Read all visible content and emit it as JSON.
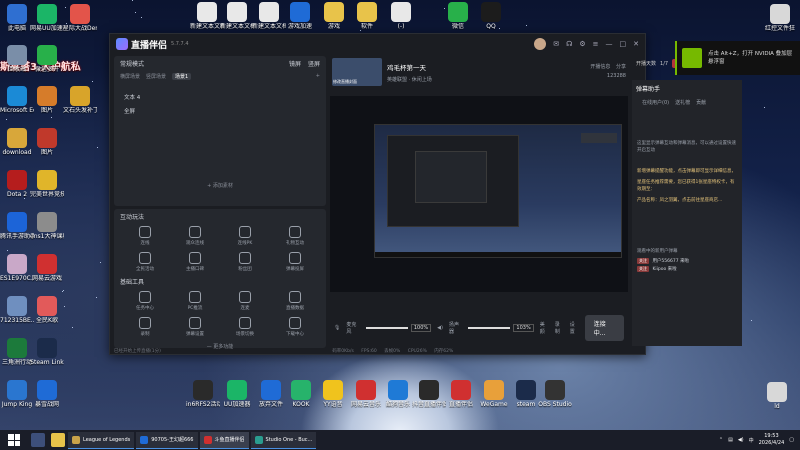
{
  "overlay_text": "斯莱塔3.大护航私",
  "desktop_icons_left": [
    {
      "label": "此电脑",
      "color": "#2f6fd1"
    },
    {
      "label": "回收站",
      "color": "#7a8ea8"
    },
    {
      "label": "Microsoft Edge",
      "color": "#1b8ad6"
    },
    {
      "label": "download",
      "color": "#d8a73a"
    },
    {
      "label": "Dota 2",
      "color": "#b51d1d"
    },
    {
      "label": "腾讯手游助手-畅玩手机...",
      "color": "#1c64d8"
    },
    {
      "label": "ES1E970C...",
      "color": "#c9a8c8"
    },
    {
      "label": "712315BE...",
      "color": "#6f8fbf"
    },
    {
      "label": "三角洲行动",
      "color": "#1c7a3b"
    },
    {
      "label": "Jump King",
      "color": "#2a76d0"
    }
  ],
  "desktop_icons_left2": [
    {
      "label": "网易UU加速器",
      "color": "#1bb567"
    },
    {
      "label": "微信多开",
      "color": "#28b04a"
    },
    {
      "label": "图片",
      "color": "#d67c2a"
    },
    {
      "label": "图片",
      "color": "#c0392b"
    },
    {
      "label": "完美世界竞技平台",
      "color": "#e0b52a"
    },
    {
      "label": "ens1大神课程笔记",
      "color": "#8c8c8c"
    },
    {
      "label": "网易云游戏",
      "color": "#d03030"
    },
    {
      "label": "全民K歌",
      "color": "#e25a5a"
    },
    {
      "label": "Steam Link",
      "color": "#1b2b4a"
    },
    {
      "label": "暴雪战网",
      "color": "#1f6bd6"
    }
  ],
  "desktop_icons_left3": [
    {
      "label": "星际大战Demo",
      "color": "#e3544a"
    },
    {
      "label": "文石头发补丁",
      "color": "#d8a42a"
    }
  ],
  "desktop_icons_top": [
    {
      "label": "新建文本文档",
      "color": "#e8e8e8"
    },
    {
      "label": "新建文本文档(2)",
      "color": "#e8e8e8"
    },
    {
      "label": "新建文本文档",
      "color": "#e8e8e8"
    },
    {
      "label": "游戏加速",
      "color": "#1f6bd6"
    },
    {
      "label": "游戏",
      "color": "#e8c34a"
    },
    {
      "label": "软件",
      "color": "#e8c34a"
    },
    {
      "label": "(-)",
      "color": "#e8e8e8"
    },
    {
      "label": "微信",
      "color": "#28b04a"
    },
    {
      "label": "QQ",
      "color": "#1c1c1c"
    }
  ],
  "desktop_icons_bottom": [
    {
      "label": "in6RFS2活动预约",
      "color": "#2a2a2a"
    },
    {
      "label": "UU加速器",
      "color": "#1bb567"
    },
    {
      "label": "放弃文件",
      "color": "#1f6bd6"
    },
    {
      "label": "KOOK",
      "color": "#27b36b"
    },
    {
      "label": "YY语音",
      "color": "#f0c31d"
    },
    {
      "label": "网易云音乐",
      "color": "#d03030"
    },
    {
      "label": "酷狗音乐",
      "color": "#1f7ad6"
    },
    {
      "label": "抖音直播伴侣",
      "color": "#2a2a2a"
    },
    {
      "label": "直播伴侣",
      "color": "#d03030"
    },
    {
      "label": "WeGame",
      "color": "#e8a03a"
    },
    {
      "label": "steam",
      "color": "#1b2b4a"
    },
    {
      "label": "OBS Studio",
      "color": "#333333"
    }
  ],
  "desktop_icons_right": [
    {
      "label": "红控文件狂",
      "color": "#d8d8d8"
    },
    {
      "label": "ld",
      "color": "#d8d8d8"
    }
  ],
  "window": {
    "app_name": "直播伴侣",
    "version": "5.7.7.4",
    "title_buttons": [
      "—",
      "□",
      "✕"
    ],
    "left": {
      "mode": "常规模式",
      "mode_actions": [
        "镜屏",
        "竖屏"
      ],
      "scene_tabs": [
        "横屏场景",
        "竖屏场景",
        "场景1"
      ],
      "sources": [
        "文本 4",
        "全屏"
      ],
      "add_source": "+ 添加素材",
      "interactive_title": "互动玩法",
      "interactive_items": [
        "连线",
        "观众连线",
        "连线PK",
        "礼物互动",
        "全民活动",
        "主播口碑",
        "粉丝团",
        "弹幕投屏"
      ],
      "tools_title": "基础工具",
      "tools_items": [
        "任务中心",
        "PC推流",
        "连麦",
        "直播数据",
        "录制",
        "弹幕设置",
        "场景切换",
        "下载中心"
      ],
      "more": "— 更多功能"
    },
    "center": {
      "thumb_text": "修改直播封面",
      "stream_title": "鸡毛杯第一天",
      "stream_category": "英雄联盟 · 休闲上场",
      "head_right": [
        "开播信息",
        "分享",
        "123288"
      ],
      "mic_label": "麦克风",
      "mic_value": 100,
      "speaker_label": "扬声器",
      "speaker_value": 103,
      "mic_pct": "100%",
      "speaker_pct": "103%",
      "buttons": [
        "美颜",
        "录制",
        "设置"
      ],
      "go_live": "连接中...",
      "status": "已经开始上传直播(1分)",
      "stats": [
        "码率0Kb/s",
        "FPS:60",
        "丢帧0%",
        "CPU26%",
        "内存62%"
      ]
    },
    "right": {
      "hdr_items": [
        "开播天数",
        "1/7",
        "关播",
        "详情"
      ],
      "assistant_title": "弹幕助手",
      "assistant_tabs": [
        "在线用户(0)",
        "送礼榜",
        "贡献"
      ],
      "messages": [
        "这里显示弹幕互动和弹幕消息，可以通过设置快速开启互动",
        "新增弹幕提醒功能，点击弹幕即可显示详细信息，",
        "星座任务推荐需要，您已获得1张星座特权卡，有效期至：",
        "产品名称：凤之羽翼，点击前往星座商店...",
        "观看中的新用户弹幕"
      ],
      "gift_rows": [
        {
          "tag": "关注",
          "text": "用户556677 来啦"
        },
        {
          "tag": "关注",
          "text": "Kiipoo 来啦"
        }
      ]
    }
  },
  "nvidia": {
    "line1": "点击 Alt+Z，打开 NVIDIA 叠加层",
    "line2": "悬浮窗"
  },
  "taskbar": {
    "tasks": [
      {
        "label": "League of Legends",
        "color": "#c9a34a"
      },
      {
        "label": "90705-王幻超666",
        "color": "#1f6bd6"
      },
      {
        "label": "斗鱼直播伴侣",
        "color": "#d03030"
      },
      {
        "label": "Studio One - Buc...",
        "color": "#2a9d8f"
      }
    ],
    "time": "19:53",
    "date": "2026/4/24"
  }
}
